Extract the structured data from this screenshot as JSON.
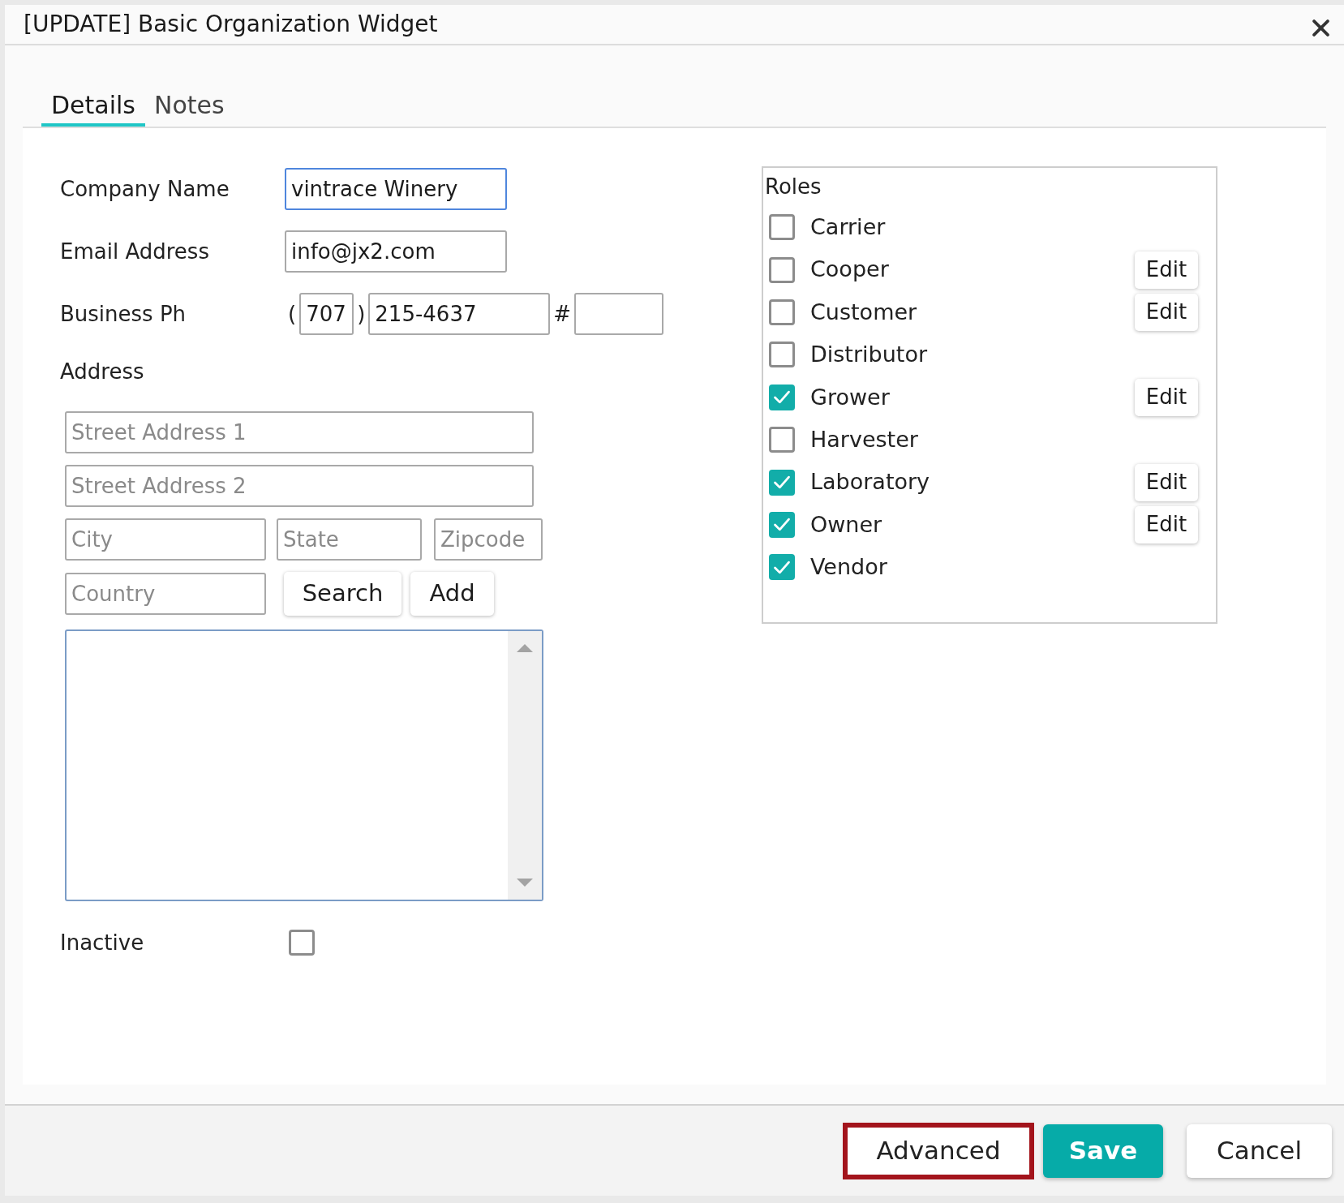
{
  "dialog": {
    "title": "[UPDATE] Basic Organization Widget"
  },
  "tabs": [
    {
      "label": "Details",
      "selected": true
    },
    {
      "label": "Notes",
      "selected": false
    }
  ],
  "details": {
    "company_name": {
      "label": "Company Name",
      "value": "vintrace Winery",
      "focused": true
    },
    "email": {
      "label": "Email Address",
      "value": "info@jx2.com",
      "focused": false
    },
    "business_phone": {
      "label": "Business Ph",
      "parts": [
        {
          "kind": "symbol",
          "text": "("
        },
        {
          "kind": "input",
          "value": "707"
        },
        {
          "kind": "symbol",
          "text": ")"
        },
        {
          "kind": "input",
          "value": "215-4637"
        },
        {
          "kind": "symbol",
          "text": "#"
        },
        {
          "kind": "input"
        }
      ]
    },
    "address": {
      "label": "Address",
      "rows": [
        [
          {
            "placeholder": "Street Address 1"
          }
        ],
        [
          {
            "placeholder": "Street Address 2"
          }
        ],
        [
          {
            "placeholder": "City"
          },
          {
            "placeholder": "State"
          },
          {
            "placeholder": "Zipcode"
          }
        ],
        [
          {
            "placeholder": "Country"
          }
        ]
      ],
      "buttons": [
        "Search",
        "Add"
      ]
    },
    "inactive": {
      "label": "Inactive",
      "checked": false
    }
  },
  "roles": {
    "title": "Roles",
    "items": [
      {
        "label": "Carrier",
        "checked": false
      },
      {
        "label": "Cooper",
        "checked": false,
        "action": "Edit"
      },
      {
        "label": "Customer",
        "checked": false,
        "action": "Edit"
      },
      {
        "label": "Distributor",
        "checked": false
      },
      {
        "label": "Grower",
        "checked": true,
        "action": "Edit"
      },
      {
        "label": "Harvester",
        "checked": false
      },
      {
        "label": "Laboratory",
        "checked": true,
        "action": "Edit"
      },
      {
        "label": "Owner",
        "checked": true,
        "action": "Edit"
      },
      {
        "label": "Vendor",
        "checked": true
      }
    ]
  },
  "footer": {
    "buttons": [
      {
        "label": "Advanced",
        "kind": "highlighted"
      },
      {
        "label": "Save",
        "kind": "primary"
      },
      {
        "label": "Cancel",
        "kind": "default"
      }
    ]
  }
}
